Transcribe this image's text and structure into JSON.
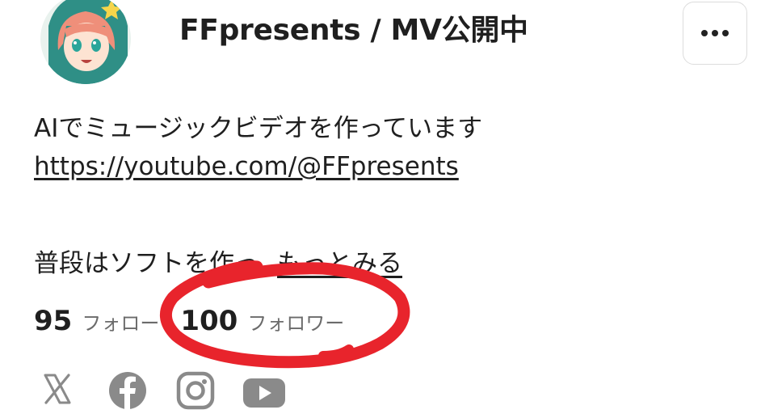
{
  "profile": {
    "name": "FFpresents / MV公開中",
    "avatar_icon": "anime-avatar-icon"
  },
  "more_button": {
    "icon": "more-horizontal-icon",
    "label": "•••"
  },
  "bio": {
    "line1": "AIでミュージックビデオを作っています",
    "link": "https://youtube.com/@FFpresents",
    "line3_text": "普段はソフトを作っ",
    "more_label": "もっとみる"
  },
  "stats": {
    "following_count": "95",
    "following_label": "フォロー",
    "followers_count": "100",
    "followers_label": "フォロワー"
  },
  "social": [
    {
      "icon": "x-icon"
    },
    {
      "icon": "facebook-icon"
    },
    {
      "icon": "instagram-icon"
    },
    {
      "icon": "youtube-icon"
    }
  ],
  "colors": {
    "annotation": "#e8242c",
    "text": "#1f1f1f",
    "muted": "#6b6b6b",
    "icon_gray": "#8a8a8a"
  }
}
